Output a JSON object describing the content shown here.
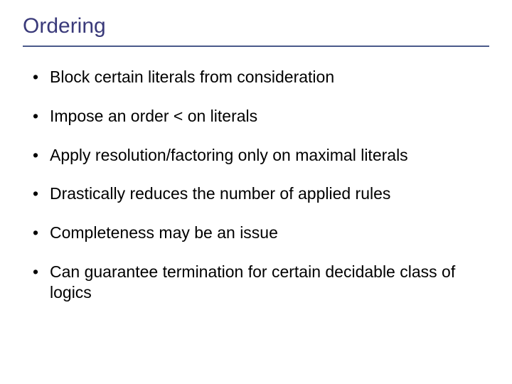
{
  "slide": {
    "title": "Ordering",
    "bullets": [
      "Block certain literals from consideration",
      "Impose an order < on literals",
      "Apply resolution/factoring only on maximal literals",
      "Drastically reduces the number of applied rules",
      "Completeness may be an issue",
      "Can guarantee termination for certain decidable class of logics"
    ]
  }
}
